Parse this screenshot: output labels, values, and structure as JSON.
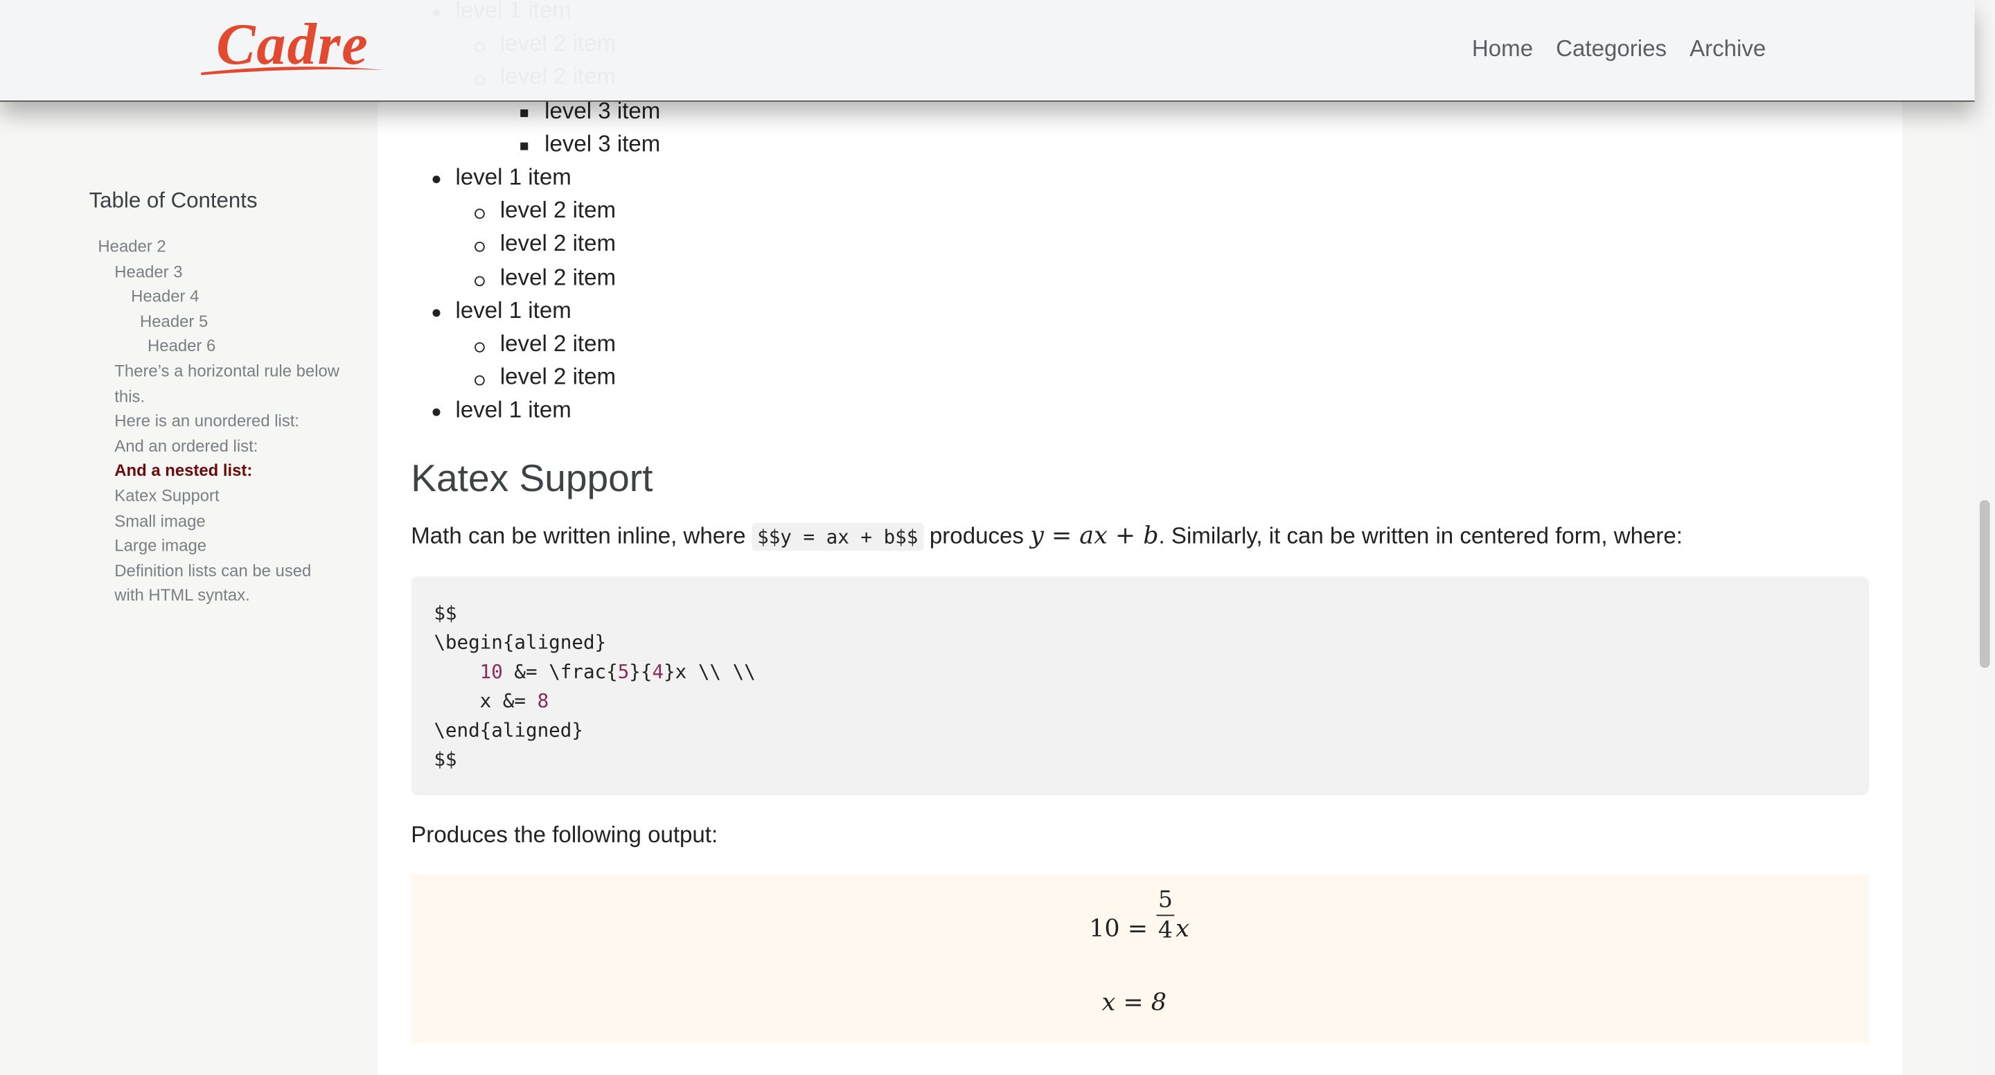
{
  "header": {
    "logo_text": "Cadre",
    "nav": [
      "Home",
      "Categories",
      "Archive"
    ]
  },
  "lists": {
    "top_items": [
      {
        "level": 1,
        "text": "level 1 item"
      },
      {
        "level": 2,
        "text": "level 2 item"
      },
      {
        "level": 2,
        "text": "level 2 item"
      },
      {
        "level": 3,
        "text": "level 3 item"
      },
      {
        "level": 3,
        "text": "level 3 item"
      },
      {
        "level": 1,
        "text": "level 1 item"
      },
      {
        "level": 2,
        "text": "level 2 item"
      },
      {
        "level": 2,
        "text": "level 2 item"
      },
      {
        "level": 2,
        "text": "level 2 item"
      },
      {
        "level": 1,
        "text": "level 1 item"
      },
      {
        "level": 2,
        "text": "level 2 item"
      },
      {
        "level": 2,
        "text": "level 2 item"
      },
      {
        "level": 1,
        "text": "level 1 item"
      }
    ]
  },
  "katex": {
    "heading": "Katex Support",
    "para_before": "Math can be written inline, where",
    "inline_code": "$$y = ax + b$$",
    "para_mid": "produces",
    "inline_math": "y = ax + b",
    "para_after": ". Similarly, it can be written in centered form, where:",
    "code_lines": [
      "$$",
      "\\begin{aligned}",
      "    10 &= \\frac{5}{4}x \\\\ \\\\",
      "    x &= 8",
      "\\end{aligned}",
      "$$"
    ],
    "output_label": "Produces the following output:",
    "out_line1_left": "10 =",
    "out_frac_num": "5",
    "out_frac_den": "4",
    "out_line1_var": "x",
    "out_line2": "x = 8"
  },
  "toc": {
    "title": "Table of Contents",
    "items": [
      {
        "label": "Header 2",
        "indent": 0
      },
      {
        "label": "Header 3",
        "indent": 1
      },
      {
        "label": "Header 4",
        "indent": 2
      },
      {
        "label": "Header 5",
        "indent": 3
      },
      {
        "label": "Header 6",
        "indent": 4
      },
      {
        "label": "There’s a horizontal rule below this.",
        "indent": 1
      },
      {
        "label": "Here is an unordered list:",
        "indent": 1
      },
      {
        "label": "And an ordered list:",
        "indent": 1
      },
      {
        "label": "And a nested list:",
        "indent": 1,
        "active": true
      },
      {
        "label": "Katex Support",
        "indent": 1
      },
      {
        "label": "Small image",
        "indent": 1
      },
      {
        "label": "Large image",
        "indent": 1
      },
      {
        "label": "Definition lists can be used with HTML syntax.",
        "indent": 1
      }
    ]
  },
  "colors": {
    "active_toc": "#6b0a0a",
    "logo_red": "#e2492e",
    "katex_bg": "#fff8ef",
    "code_number": "#8a2a58"
  }
}
